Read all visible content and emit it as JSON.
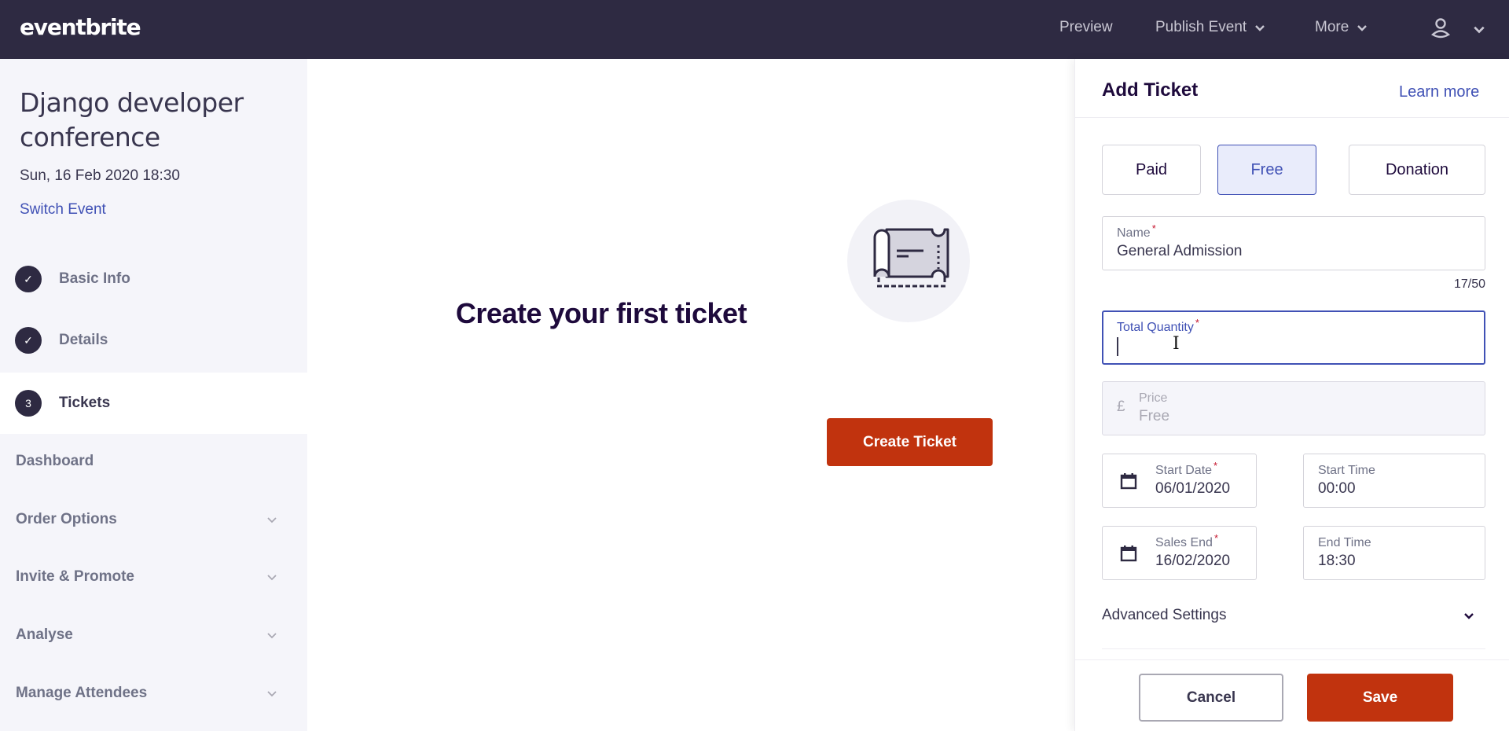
{
  "header": {
    "logo": "eventbrite",
    "nav": {
      "preview": "Preview",
      "publish_event": "Publish Event",
      "more": "More"
    },
    "icons": {
      "user": "user-icon",
      "chevron": "chevron-down-icon"
    }
  },
  "sidebar": {
    "event_title": "Django developer conference",
    "event_date": "Sun, 16 Feb 2020 18:30",
    "switch_event": "Switch Event",
    "steps": [
      {
        "label": "Basic Info",
        "status": "complete",
        "marker": "✓"
      },
      {
        "label": "Details",
        "status": "complete",
        "marker": "✓"
      },
      {
        "label": "Tickets",
        "status": "active",
        "marker": "3"
      }
    ],
    "links": [
      {
        "label": "Dashboard",
        "expandable": false
      },
      {
        "label": "Order Options",
        "expandable": true
      },
      {
        "label": "Invite & Promote",
        "expandable": true
      },
      {
        "label": "Analyse",
        "expandable": true
      },
      {
        "label": "Manage Attendees",
        "expandable": true
      }
    ]
  },
  "main": {
    "illustration": "ticket-illustration",
    "heading": "Create your first ticket",
    "create_button": "Create Ticket"
  },
  "panel": {
    "title": "Add Ticket",
    "learn_more": "Learn more",
    "ticket_types": [
      {
        "label": "Paid",
        "selected": false
      },
      {
        "label": "Free",
        "selected": true
      },
      {
        "label": "Donation",
        "selected": false
      }
    ],
    "name": {
      "label": "Name",
      "required": "*",
      "value": "General Admission",
      "counter": "17/50"
    },
    "quantity": {
      "label": "Total Quantity",
      "required": "*",
      "value": "",
      "focused": true
    },
    "price": {
      "currency": "£",
      "label": "Price",
      "value": "Free",
      "disabled": true
    },
    "start_date": {
      "label": "Start Date",
      "required": "*",
      "value": "06/01/2020"
    },
    "start_time": {
      "label": "Start Time",
      "value": "00:00"
    },
    "sales_end": {
      "label": "Sales End",
      "required": "*",
      "value": "16/02/2020"
    },
    "end_time": {
      "label": "End Time",
      "value": "18:30"
    },
    "advanced_settings": "Advanced Settings",
    "cancel": "Cancel",
    "save": "Save"
  },
  "colors": {
    "topbar": "#2e2a42",
    "sidebar_bg": "#f5f5fa",
    "primary_action": "#c1330e",
    "link_blue": "#4051b5",
    "selected_bg": "#e9ecfb",
    "required_star": "#c5162e"
  }
}
